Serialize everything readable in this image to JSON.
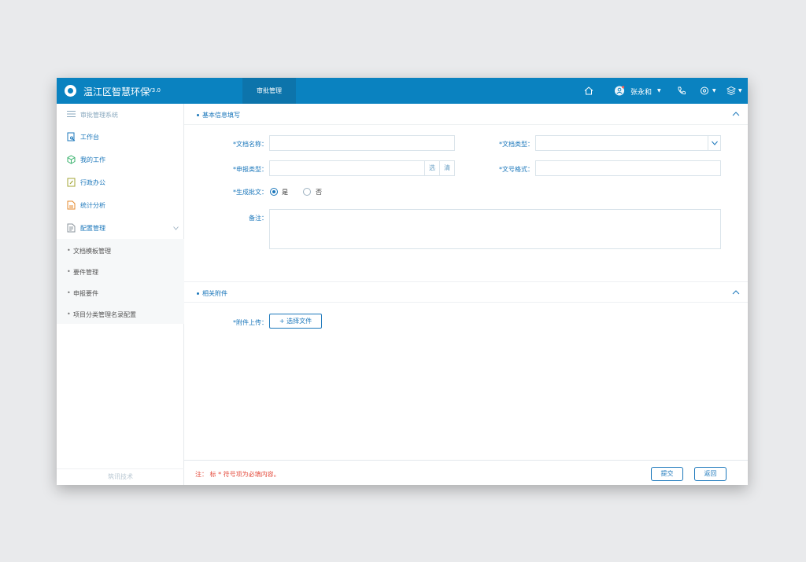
{
  "header": {
    "app_title": "温江区智慧环保",
    "version": "V3.0",
    "nav_tab": "审批管理",
    "user_name": "张永和",
    "icons": [
      "home-icon",
      "user-icon",
      "phone-icon",
      "settings-icon",
      "layers-icon"
    ],
    "colors": {
      "primary": "#0a82c0",
      "active_tab": "#0d74ab"
    }
  },
  "sidebar": {
    "header_label": "审批管理系统",
    "items": [
      {
        "label": "工作台",
        "icon": "workbench-icon"
      },
      {
        "label": "我的工作",
        "icon": "box-icon"
      },
      {
        "label": "行政办公",
        "icon": "document-edit-icon"
      },
      {
        "label": "统计分析",
        "icon": "chart-icon"
      },
      {
        "label": "配置管理",
        "icon": "config-icon"
      }
    ],
    "sub_items": [
      "文档模板管理",
      "要件管理",
      "申报要件",
      "项目分类管理名录配置"
    ],
    "footer": "筑讯技术"
  },
  "form": {
    "section_basic": "基本信息填写",
    "doc_name_label": "*文档名称：",
    "doc_type_label": "*文档类型：",
    "apply_type_label": "*申报类型：",
    "choose_btn": "选",
    "clear_btn": "清",
    "doc_format_label": "*文号格式：",
    "generate_label": "*生成批文：",
    "radio_yes": "是",
    "radio_no": "否",
    "remark_label": "备注：",
    "section_attach": "相关附件",
    "attach_label": "*附件上传：",
    "upload_btn": "+ 选择文件"
  },
  "footer": {
    "note": "注： 标 * 符号项为必填内容。",
    "submit": "提交",
    "back": "返回"
  }
}
